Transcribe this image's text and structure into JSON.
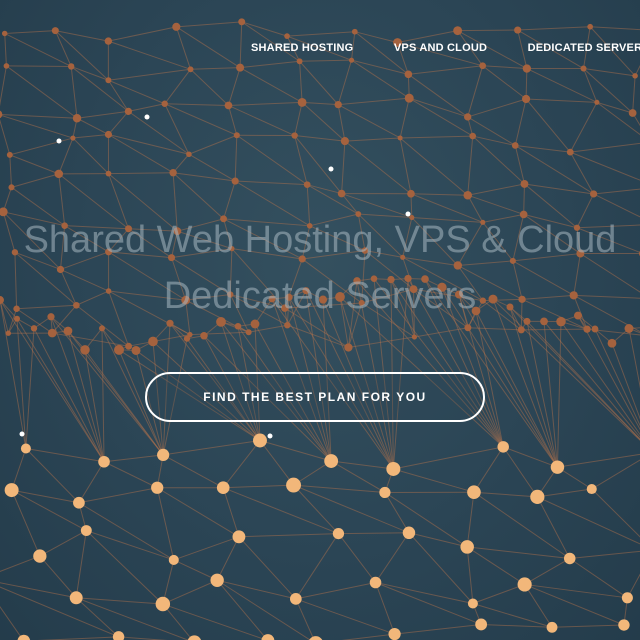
{
  "nav": {
    "items": [
      {
        "label": "SHARED HOSTING"
      },
      {
        "label": "VPS AND CLOUD"
      },
      {
        "label": "DEDICATED SERVERS"
      }
    ]
  },
  "hero": {
    "headline_line1": "Shared Web Hosting, VPS & Cloud",
    "headline_line2": "Dedicated Servers",
    "cta_label": "FIND THE BEST PLAN FOR YOU"
  },
  "colors": {
    "background": "#2b4555",
    "node": "#e8a870",
    "link": "#b8744c",
    "text": "#ffffff"
  }
}
